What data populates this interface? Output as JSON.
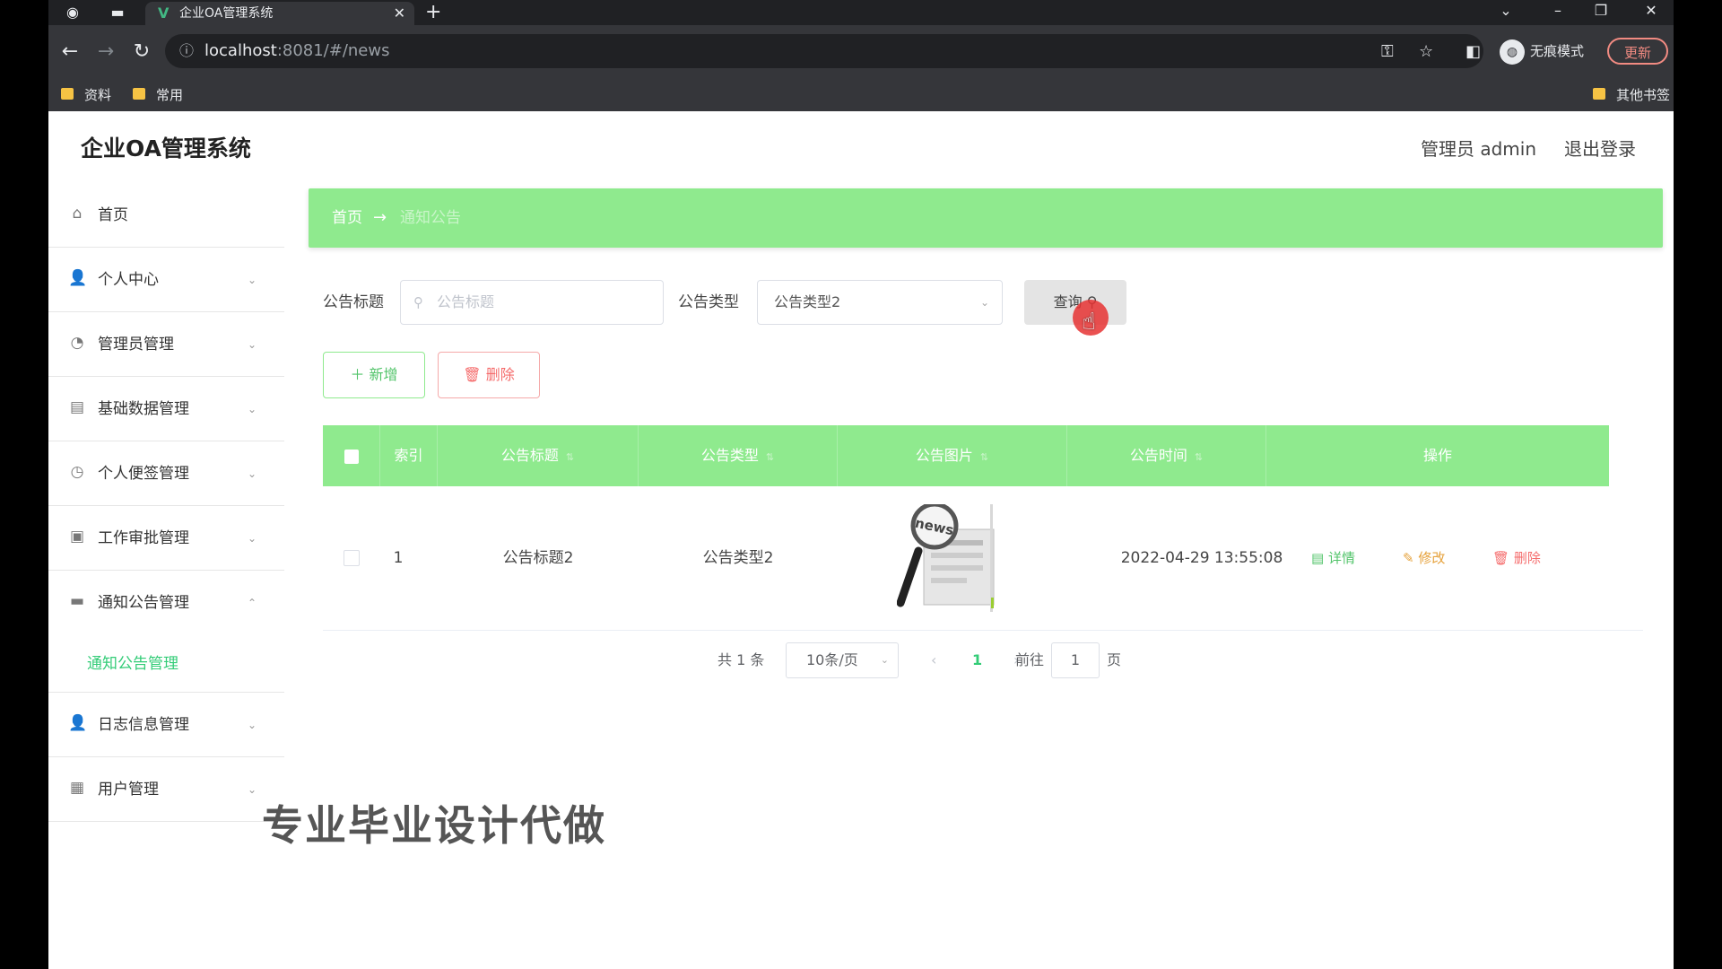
{
  "browser": {
    "tab_title": "企业OA管理系统",
    "url_host": "localhost",
    "url_rest": ":8081/#/news",
    "incognito_label": "无痕模式",
    "update_label": "更新",
    "bookmarks": [
      "资料",
      "常用"
    ],
    "other_bookmarks": "其他书签"
  },
  "header": {
    "title": "企业OA管理系统",
    "user": "管理员 admin",
    "logout": "退出登录"
  },
  "sidebar": {
    "items": [
      {
        "label": "首页",
        "icon": "home-icon"
      },
      {
        "label": "个人中心",
        "icon": "user-icon"
      },
      {
        "label": "管理员管理",
        "icon": "admin-icon"
      },
      {
        "label": "基础数据管理",
        "icon": "briefcase-icon"
      },
      {
        "label": "个人便签管理",
        "icon": "clock-icon"
      },
      {
        "label": "工作审批管理",
        "icon": "clipboard-icon"
      },
      {
        "label": "通知公告管理",
        "icon": "notice-icon"
      },
      {
        "label": "日志信息管理",
        "icon": "user-icon"
      },
      {
        "label": "用户管理",
        "icon": "user-manage-icon"
      }
    ],
    "subitem": "通知公告管理"
  },
  "breadcrumb": {
    "home": "首页",
    "separator": "→",
    "current": "通知公告"
  },
  "search": {
    "title_label": "公告标题",
    "title_placeholder": "公告标题",
    "type_label": "公告类型",
    "type_value": "公告类型2",
    "query_label": "查询"
  },
  "actions": {
    "add": "新增",
    "delete": "删除"
  },
  "table": {
    "headers": [
      "索引",
      "公告标题",
      "公告类型",
      "公告图片",
      "公告时间",
      "操作"
    ],
    "rows": [
      {
        "index": "1",
        "title": "公告标题2",
        "type": "公告类型2",
        "image_label": "news",
        "time": "2022-04-29 13:55:08",
        "detail": "详情",
        "edit": "修改",
        "delete": "删除"
      }
    ]
  },
  "pagination": {
    "total": "共 1 条",
    "page_size": "10条/页",
    "current_page": "1",
    "goto_prefix": "前往",
    "goto_value": "1",
    "goto_suffix": "页"
  },
  "watermark": "专业毕业设计代做",
  "colors": {
    "accent_green": "#8fea8e",
    "active_green": "#33cc77",
    "danger": "#f56c6c",
    "warning": "#e6a23c"
  }
}
